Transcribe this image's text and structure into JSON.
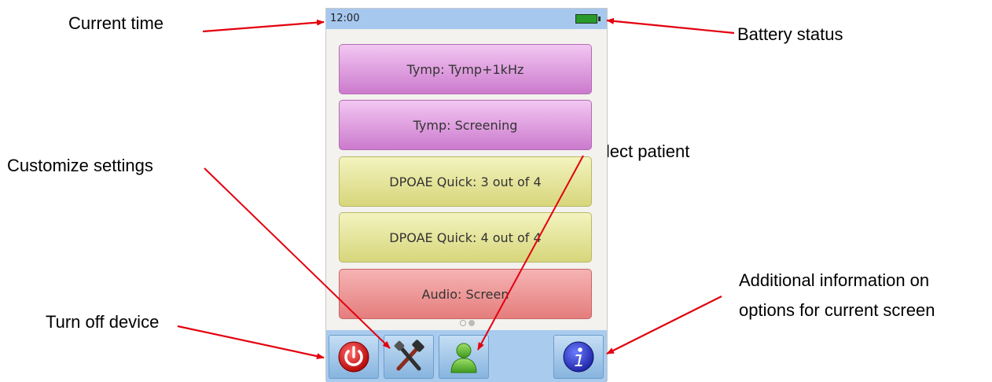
{
  "device": {
    "status_bar": {
      "time": "12:00",
      "battery_icon": "battery-full-icon"
    },
    "tests": [
      {
        "label": "Tymp: Tymp+1kHz",
        "color": "purple"
      },
      {
        "label": "Tymp: Screening",
        "color": "purple"
      },
      {
        "label": "DPOAE Quick: 3 out of 4",
        "color": "yellow"
      },
      {
        "label": "DPOAE Quick: 4 out of 4",
        "color": "yellow"
      },
      {
        "label": "Audio: Screen",
        "color": "red"
      }
    ],
    "pager": {
      "pages": 2,
      "current": 2
    },
    "toolbar": {
      "power_icon": "power-icon",
      "settings_icon": "settings-tools-icon",
      "patient_icon": "patient-icon",
      "info_icon": "info-icon"
    }
  },
  "annotations": {
    "current_time": "Current time",
    "battery_status": "Battery status",
    "customize_settings": "Customize settings",
    "select_patient": "Select patient",
    "turn_off_device": "Turn off device",
    "additional_info_line1": "Additional information on",
    "additional_info_line2": "options for current screen"
  },
  "colors": {
    "status_bar": "#a6c8ef",
    "toolbar": "#a8cbee",
    "arrow": "#e3000f",
    "purple_button": "#e0a3e0",
    "yellow_button": "#e4e39b",
    "red_button": "#ee9999"
  }
}
